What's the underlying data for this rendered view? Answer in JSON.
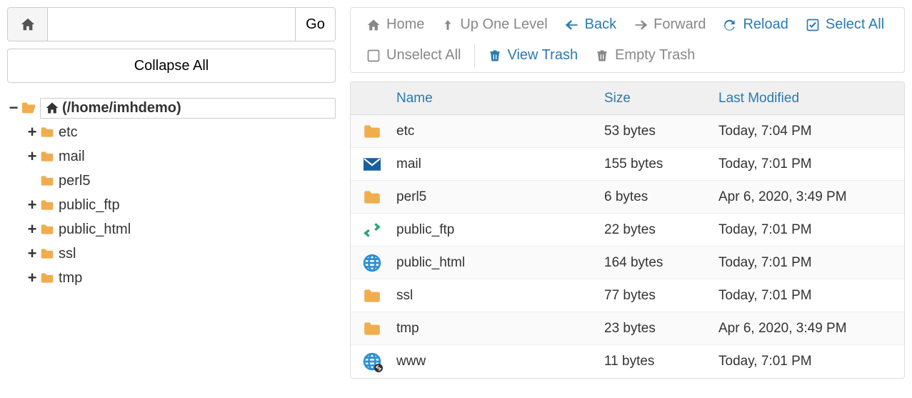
{
  "pathbar": {
    "input_value": "",
    "go_label": "Go"
  },
  "collapse_label": "Collapse All",
  "tree": {
    "root_label": "(/home/imhdemo)",
    "items": [
      {
        "label": "etc",
        "expander": "+"
      },
      {
        "label": "mail",
        "expander": "+"
      },
      {
        "label": "perl5",
        "expander": ""
      },
      {
        "label": "public_ftp",
        "expander": "+"
      },
      {
        "label": "public_html",
        "expander": "+"
      },
      {
        "label": "ssl",
        "expander": "+"
      },
      {
        "label": "tmp",
        "expander": "+"
      }
    ]
  },
  "toolbar": {
    "home": "Home",
    "up": "Up One Level",
    "back": "Back",
    "forward": "Forward",
    "reload": "Reload",
    "select_all": "Select All",
    "unselect_all": "Unselect All",
    "view_trash": "View Trash",
    "empty_trash": "Empty Trash"
  },
  "columns": {
    "name": "Name",
    "size": "Size",
    "modified": "Last Modified"
  },
  "files": [
    {
      "icon": "folder",
      "name": "etc",
      "size": "53 bytes",
      "modified": "Today, 7:04 PM"
    },
    {
      "icon": "mail",
      "name": "mail",
      "size": "155 bytes",
      "modified": "Today, 7:01 PM"
    },
    {
      "icon": "folder",
      "name": "perl5",
      "size": "6 bytes",
      "modified": "Apr 6, 2020, 3:49 PM"
    },
    {
      "icon": "arrows",
      "name": "public_ftp",
      "size": "22 bytes",
      "modified": "Today, 7:01 PM"
    },
    {
      "icon": "globe",
      "name": "public_html",
      "size": "164 bytes",
      "modified": "Today, 7:01 PM"
    },
    {
      "icon": "folder",
      "name": "ssl",
      "size": "77 bytes",
      "modified": "Today, 7:01 PM"
    },
    {
      "icon": "folder",
      "name": "tmp",
      "size": "23 bytes",
      "modified": "Apr 6, 2020, 3:49 PM"
    },
    {
      "icon": "globe-link",
      "name": "www",
      "size": "11 bytes",
      "modified": "Today, 7:01 PM"
    }
  ]
}
